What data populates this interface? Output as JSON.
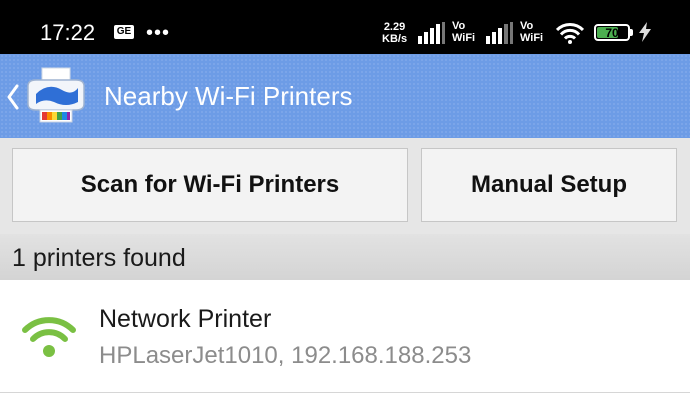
{
  "status_bar": {
    "time": "17:22",
    "ge_badge": "GE",
    "more_dots": "•••",
    "speed_value": "2.29",
    "speed_unit": "KB/s",
    "volte_1_top": "Vo",
    "volte_1_bottom": "WiFi",
    "volte_2_top": "Vo",
    "volte_2_bottom": "WiFi",
    "battery": "70",
    "battery_level": 0.7,
    "battery_color": "#4caf50"
  },
  "app_bar": {
    "title": "Nearby Wi-Fi Printers",
    "background_color": "#6d9ce6"
  },
  "buttons": {
    "scan": "Scan for Wi-Fi Printers",
    "manual": "Manual Setup"
  },
  "section": {
    "header": "1 printers found"
  },
  "printers": [
    {
      "name": "Network Printer",
      "detail": "HPLaserJet1010, 192.168.188.253",
      "icon": "wifi-icon",
      "icon_color": "#7ac043"
    }
  ],
  "icons": {
    "back": "chevron-left-icon",
    "logo": "printer-app-logo-icon",
    "wifi_status": "wifi-signal-icon",
    "cell_signal": "cell-signal-icon",
    "charging": "lightning-bolt-icon"
  }
}
